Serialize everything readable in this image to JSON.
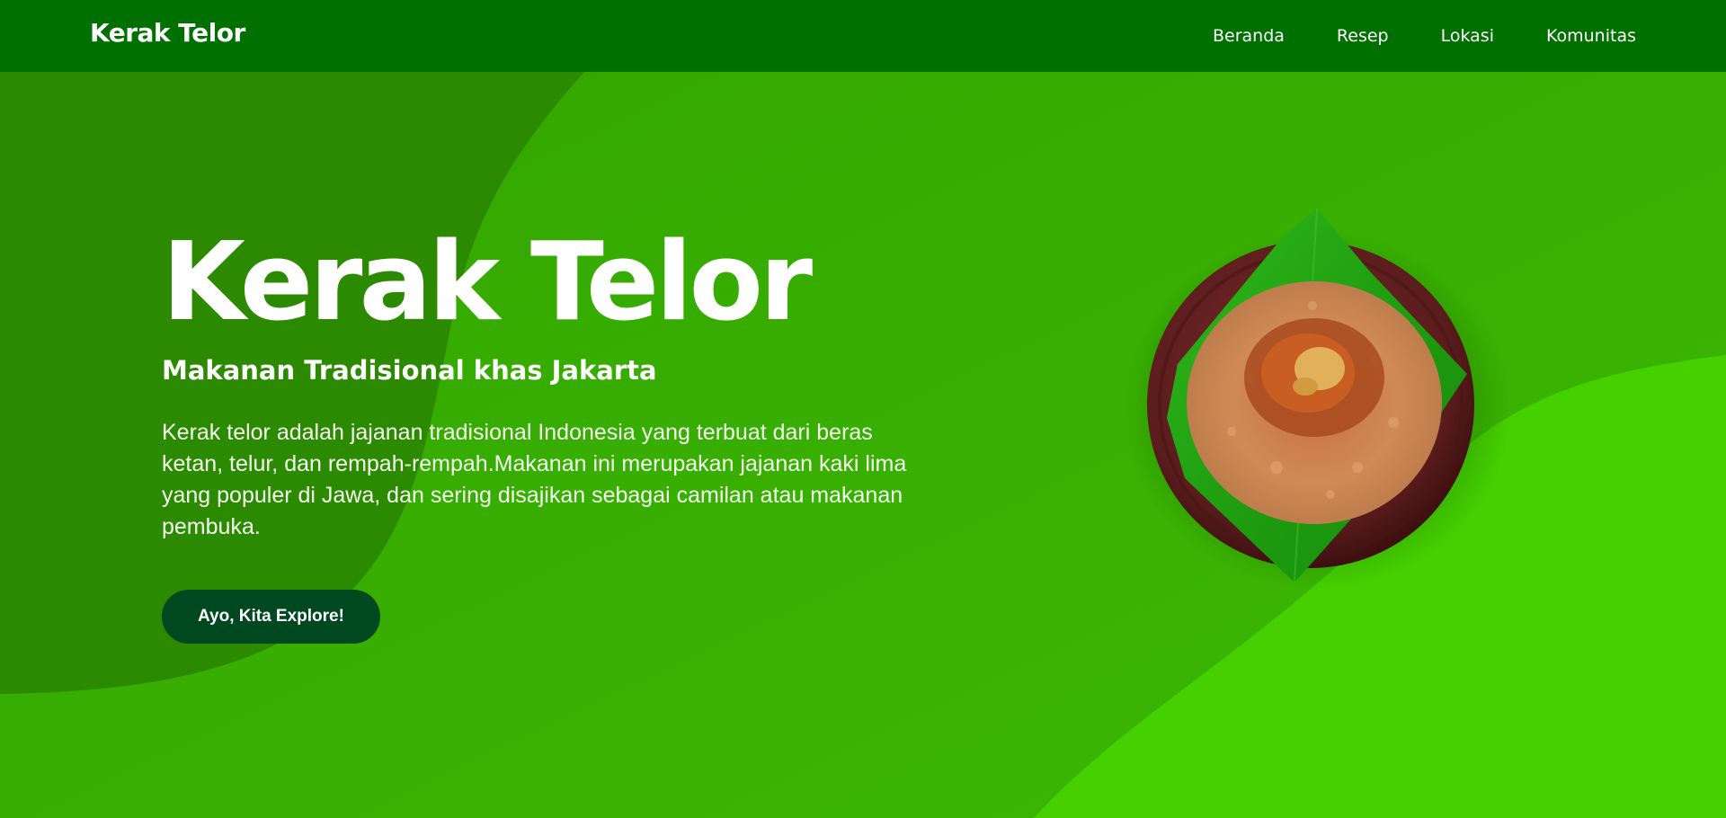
{
  "navbar": {
    "brand": "Kerak Telor",
    "links": [
      {
        "label": "Beranda"
      },
      {
        "label": "Resep"
      },
      {
        "label": "Lokasi"
      },
      {
        "label": "Komunitas"
      }
    ]
  },
  "hero": {
    "title": "Kerak Telor",
    "subtitle": "Makanan Tradisional khas Jakarta",
    "description": "Kerak telor adalah jajanan tradisional Indonesia yang terbuat dari beras ketan, telur, dan rempah-rempah.Makanan ini merupakan jajanan kaki lima yang populer di Jawa, dan sering disajikan sebagai camilan atau makanan pembuka.",
    "cta_label": "Ayo, Kita Explore!"
  },
  "image": {
    "subject": "kerak-telor-dish"
  },
  "colors": {
    "navbar": "#007000",
    "background": "#3aad02",
    "wave_dark": "#2c8a00",
    "wave_light": "#45d000",
    "button": "#004820",
    "text": "#ffffff"
  }
}
